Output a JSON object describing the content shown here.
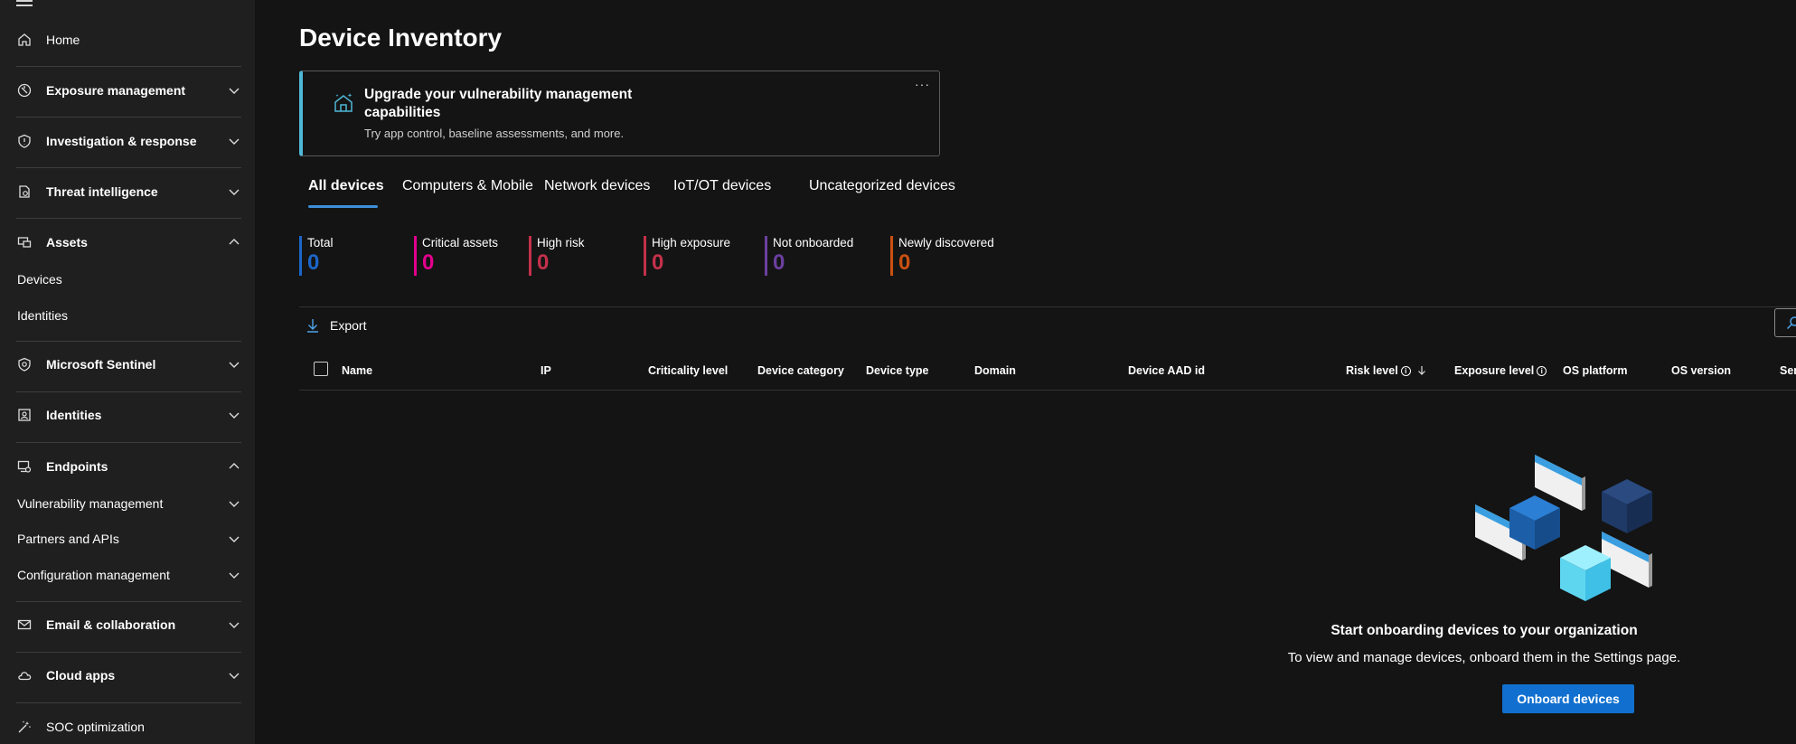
{
  "sidebar": {
    "home": "Home",
    "exposure_management": "Exposure management",
    "investigation_response": "Investigation & response",
    "threat_intelligence": "Threat intelligence",
    "assets": "Assets",
    "devices": "Devices",
    "identities_sub": "Identities",
    "microsoft_sentinel": "Microsoft Sentinel",
    "identities": "Identities",
    "endpoints": "Endpoints",
    "vulnerability_management": "Vulnerability management",
    "partners_apis": "Partners and APIs",
    "configuration_management": "Configuration management",
    "email_collaboration": "Email & collaboration",
    "cloud_apps": "Cloud apps",
    "soc_optimization": "SOC optimization"
  },
  "page": {
    "title": "Device Inventory"
  },
  "promo": {
    "title": "Upgrade your vulnerability management capabilities",
    "subtitle": "Try app control, baseline assessments, and more.",
    "more": "···"
  },
  "tabs": [
    "All devices",
    "Computers & Mobile",
    "Network devices",
    "IoT/OT devices",
    "Uncategorized devices"
  ],
  "stats": [
    {
      "label": "Total",
      "value": "0",
      "color": "#1b66c9"
    },
    {
      "label": "Critical assets",
      "value": "0",
      "color": "#e3008c"
    },
    {
      "label": "High risk",
      "value": "0",
      "color": "#c4314b"
    },
    {
      "label": "High exposure",
      "value": "0",
      "color": "#c4314b"
    },
    {
      "label": "Not onboarded",
      "value": "0",
      "color": "#6b3fa0"
    },
    {
      "label": "Newly discovered",
      "value": "0",
      "color": "#ca5010"
    }
  ],
  "toolbar": {
    "export": "Export"
  },
  "table": {
    "columns": [
      "Name",
      "IP",
      "Criticality level",
      "Device category",
      "Device type",
      "Domain",
      "Device AAD id",
      "Risk level",
      "Exposure level",
      "OS platform",
      "OS version",
      "Ser"
    ]
  },
  "empty_state": {
    "title": "Start onboarding devices to your organization",
    "subtitle": "To view and manage devices, onboard them in the Settings page.",
    "button": "Onboard devices"
  }
}
